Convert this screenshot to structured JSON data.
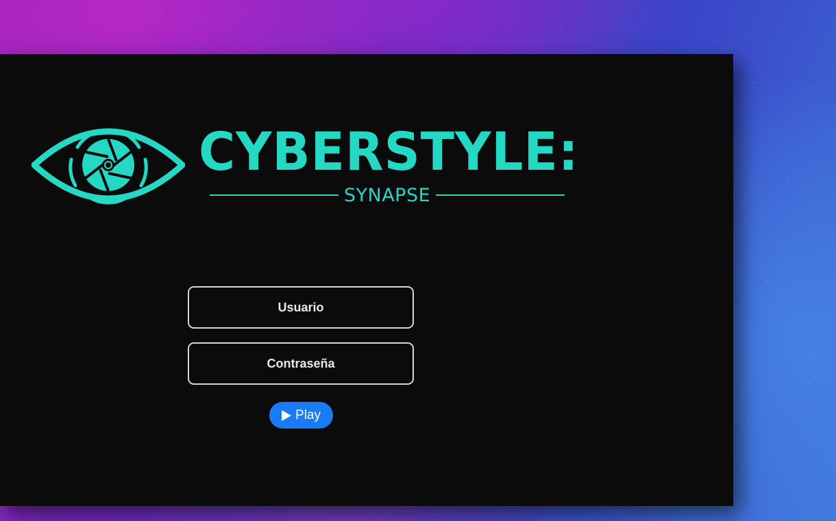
{
  "game": {
    "logo_title": "CYBERSTYLE:",
    "logo_subtitle": "SYNAPSE",
    "logo_icon": "eye-aperture-icon",
    "accent_color": "#25d8c4"
  },
  "login_form": {
    "username_label": "Usuario",
    "password_label": "Contraseña",
    "play_label": "Play",
    "play_icon": "play-icon",
    "play_color": "#1a7cf5"
  }
}
